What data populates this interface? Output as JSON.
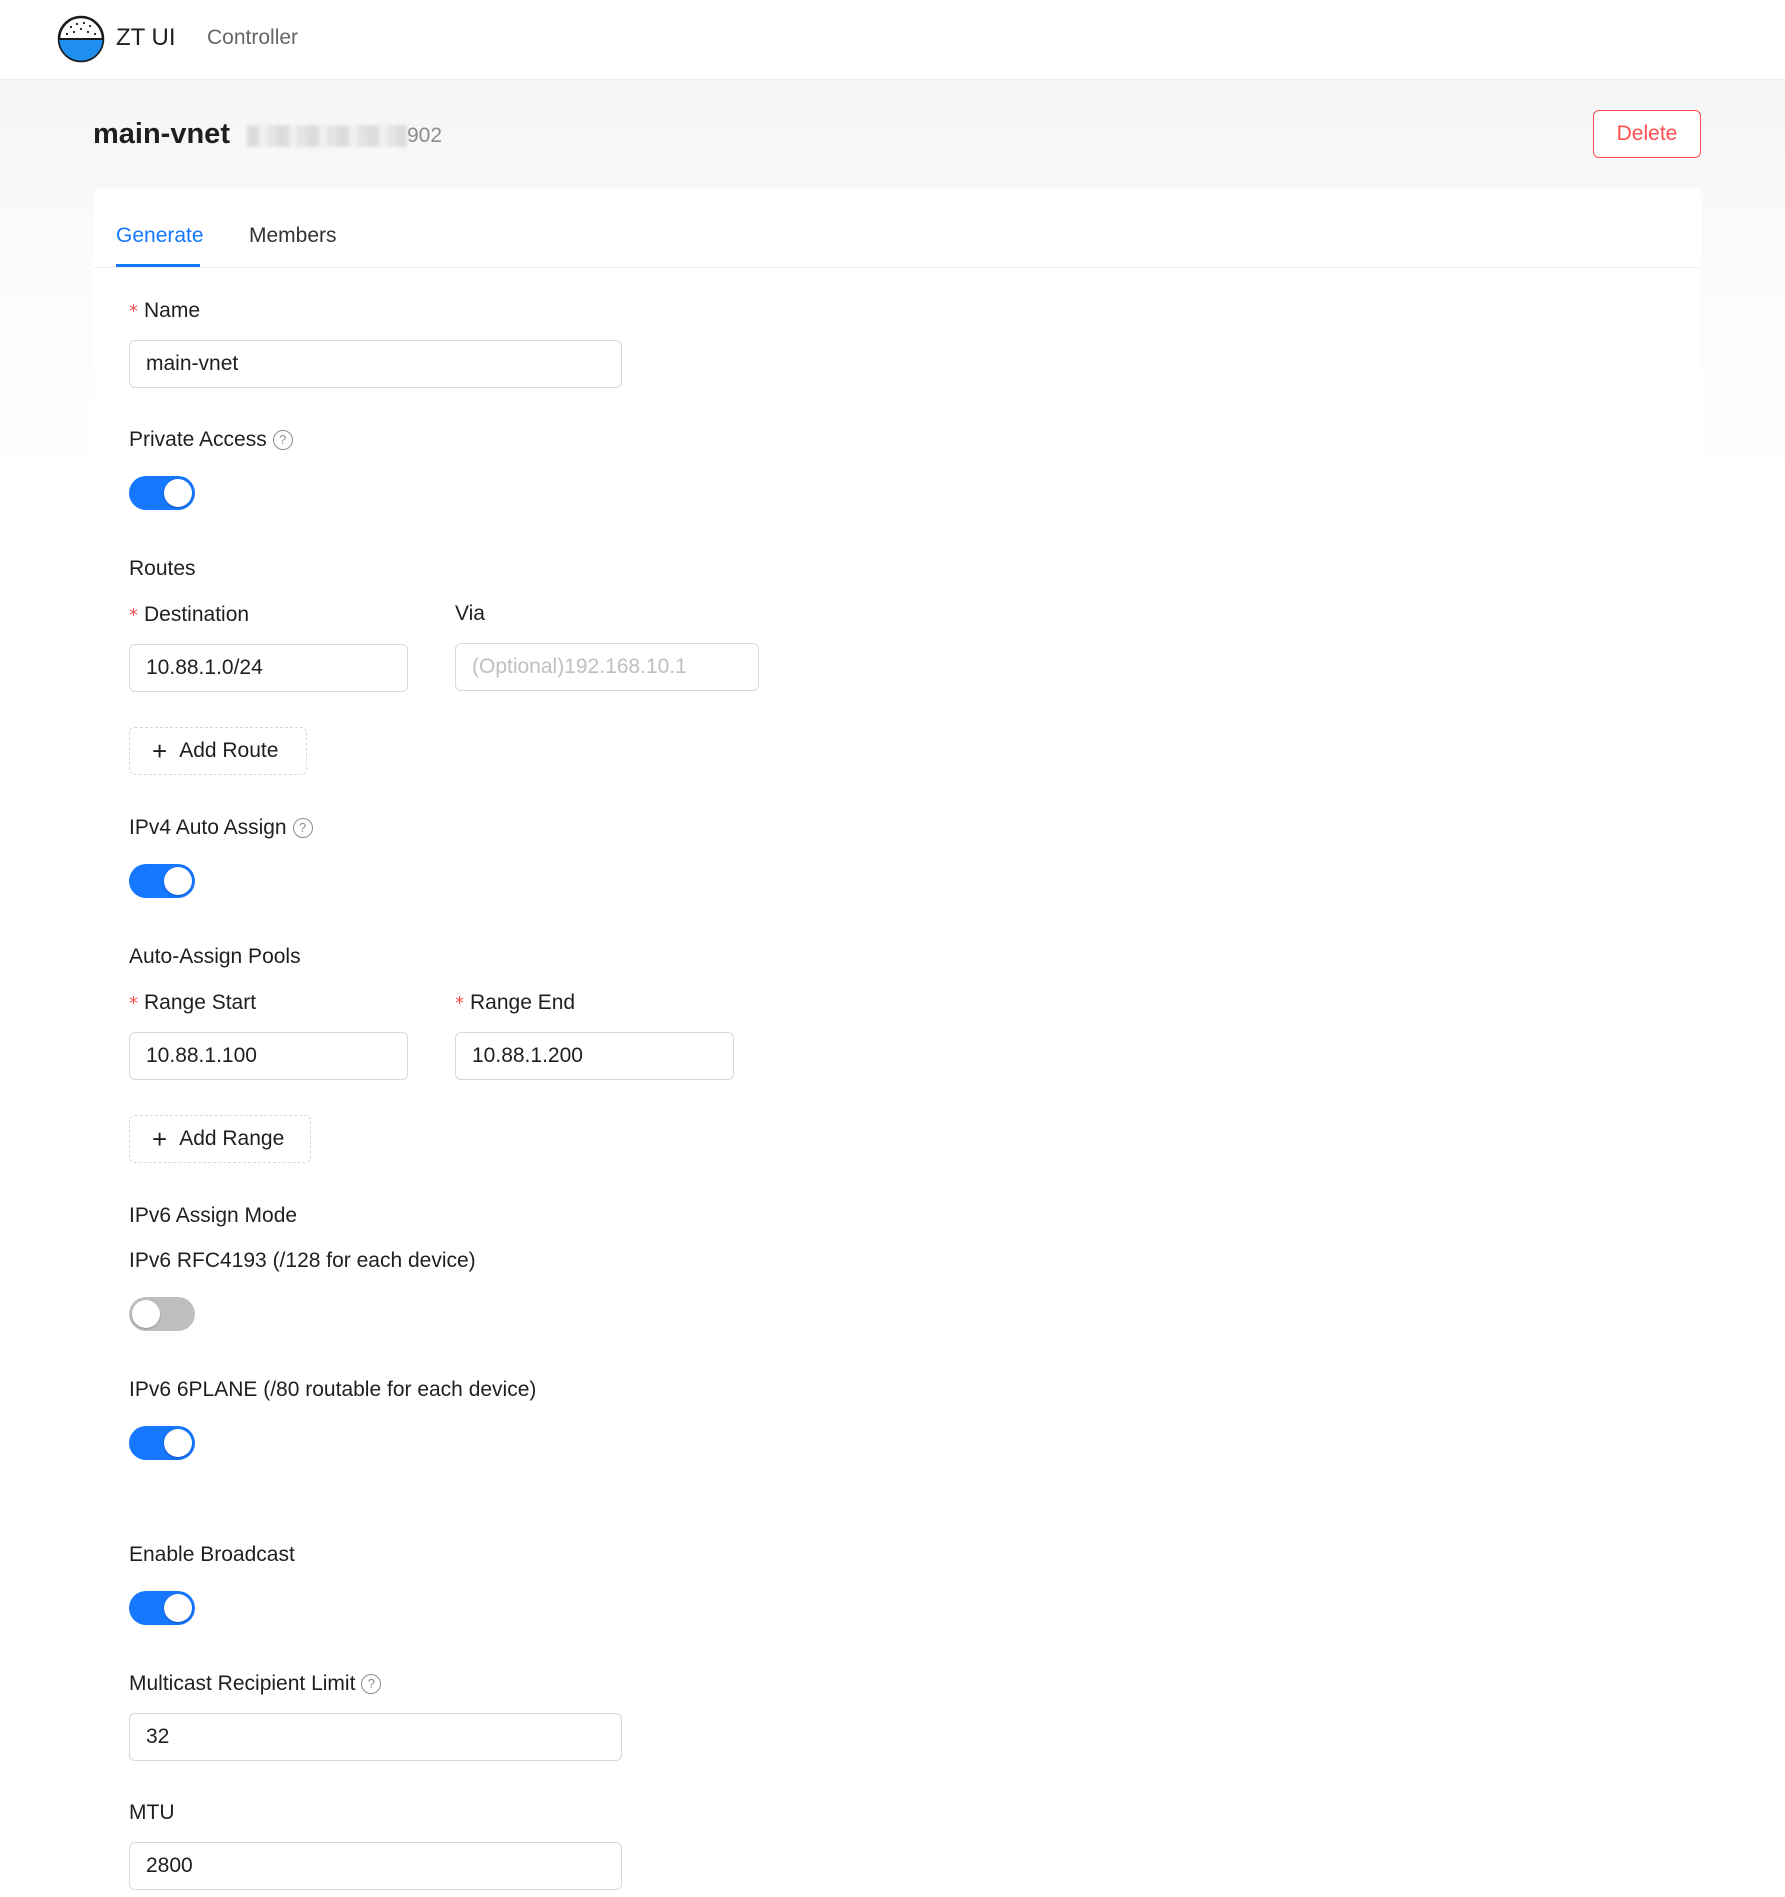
{
  "header": {
    "brand": "ZT UI",
    "nav_controller": "Controller"
  },
  "page": {
    "title": "main-vnet",
    "network_id_suffix": "902",
    "delete_label": "Delete"
  },
  "tabs": [
    {
      "label": "Generate",
      "active": true
    },
    {
      "label": "Members",
      "active": false
    }
  ],
  "form": {
    "name": {
      "label": "Name",
      "value": "main-vnet"
    },
    "private_access": {
      "label": "Private Access",
      "enabled": true
    },
    "routes": {
      "section_label": "Routes",
      "destination_label": "Destination",
      "via_label": "Via",
      "destination_value": "10.88.1.0/24",
      "via_placeholder": "(Optional)192.168.10.1",
      "add_label": "Add Route"
    },
    "ipv4_auto_assign": {
      "label": "IPv4 Auto Assign",
      "enabled": true
    },
    "pools": {
      "section_label": "Auto-Assign Pools",
      "range_start_label": "Range Start",
      "range_end_label": "Range End",
      "range_start_value": "10.88.1.100",
      "range_end_value": "10.88.1.200",
      "add_label": "Add Range"
    },
    "ipv6": {
      "section_label": "IPv6 Assign Mode",
      "rfc4193_label": "IPv6 RFC4193 (/128 for each device)",
      "rfc4193_enabled": false,
      "sixplane_label": "IPv6 6PLANE (/80 routable for each device)",
      "sixplane_enabled": true
    },
    "broadcast": {
      "label": "Enable Broadcast",
      "enabled": true
    },
    "multicast": {
      "label": "Multicast Recipient Limit",
      "value": "32"
    },
    "mtu": {
      "label": "MTU",
      "value": "2800"
    }
  },
  "icons": {
    "help": "question-circle-icon",
    "plus": "plus-icon",
    "logo": "rice-bowl-logo"
  },
  "colors": {
    "primary": "#1677ff",
    "danger": "#ff4d4f",
    "switch_off": "#bfbfbf"
  }
}
